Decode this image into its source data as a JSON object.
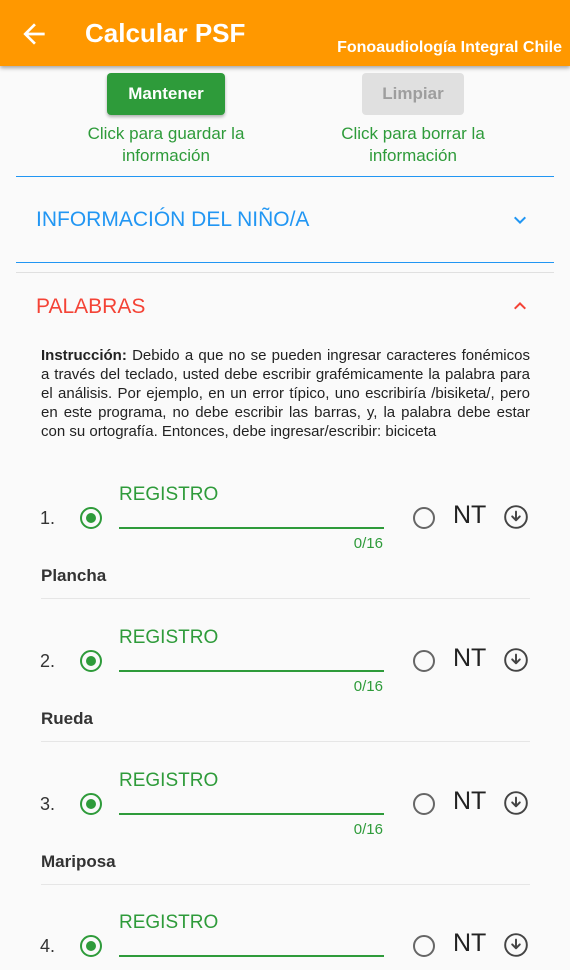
{
  "appbar": {
    "title": "Calcular PSF",
    "brand": "Fonoaudiología Integral Chile",
    "back_icon": "arrow-back-icon"
  },
  "actions": {
    "keep_label": "Mantener",
    "keep_hint": "Click para guardar la información",
    "clear_label": "Limpiar",
    "clear_hint": "Click para borrar la información"
  },
  "sections": {
    "child_info": {
      "title": "INFORMACIÓN DEL NIÑO/A",
      "expanded": false,
      "color": "#2196f3"
    },
    "words": {
      "title": "PALABRAS",
      "expanded": true,
      "color": "#f44336"
    }
  },
  "instruction": {
    "label": "Instrucción:",
    "text": "Debido a que no se pueden ingresar caracteres fonémicos a través del teclado, usted debe escribir grafémicamente la palabra para el análisis. Por ejemplo, en un error típico, uno escribiría /bisiketa/, pero en este programa, no debe escribir las barras, y, la palabra debe estar con su ortografía. Entonces, debe ingresar/escribir: biciceta"
  },
  "items": [
    {
      "number": "1.",
      "field_label": "REGISTRO",
      "value": "",
      "counter": "0/16",
      "nt_label": "NT",
      "word": "Plancha"
    },
    {
      "number": "2.",
      "field_label": "REGISTRO",
      "value": "",
      "counter": "0/16",
      "nt_label": "NT",
      "word": "Rueda"
    },
    {
      "number": "3.",
      "field_label": "REGISTRO",
      "value": "",
      "counter": "0/16",
      "nt_label": "NT",
      "word": "Mariposa"
    },
    {
      "number": "4.",
      "field_label": "REGISTRO",
      "value": "",
      "counter": "",
      "nt_label": "NT",
      "word": ""
    }
  ],
  "colors": {
    "appbar": "#ff9800",
    "accent_green": "#2e9b3a",
    "section_blue": "#2196f3",
    "section_red": "#f44336"
  }
}
